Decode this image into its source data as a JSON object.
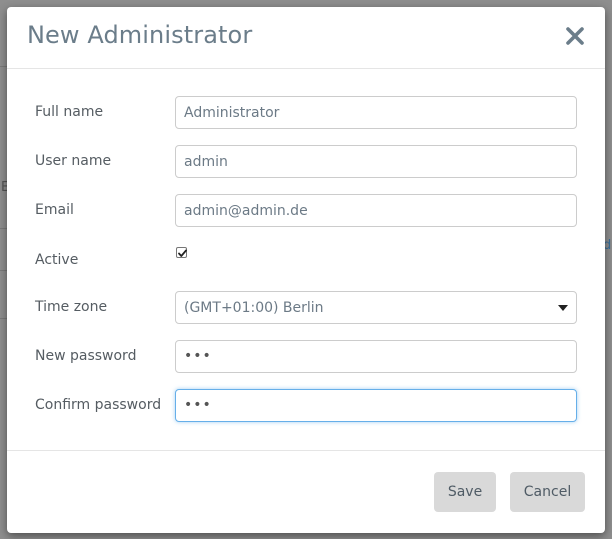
{
  "dialog": {
    "title": "New Administrator",
    "close_icon": "close-icon"
  },
  "form": {
    "full_name": {
      "label": "Full name",
      "value": "Administrator"
    },
    "user_name": {
      "label": "User name",
      "value": "admin"
    },
    "email": {
      "label": "Email",
      "value": "admin@admin.de"
    },
    "active": {
      "label": "Active",
      "checked": true
    },
    "time_zone": {
      "label": "Time zone",
      "value": "(GMT+01:00) Berlin"
    },
    "new_password": {
      "label": "New password",
      "masked": "•••"
    },
    "confirm_password": {
      "label": "Confirm password",
      "masked": "•••"
    }
  },
  "footer": {
    "save_label": "Save",
    "cancel_label": "Cancel"
  },
  "background": {
    "glyph_left": "E",
    "glyph_right": "d"
  },
  "colors": {
    "title": "#6b7d8a",
    "focus_border": "#66afe9",
    "button_bg": "#d9d9d9"
  }
}
